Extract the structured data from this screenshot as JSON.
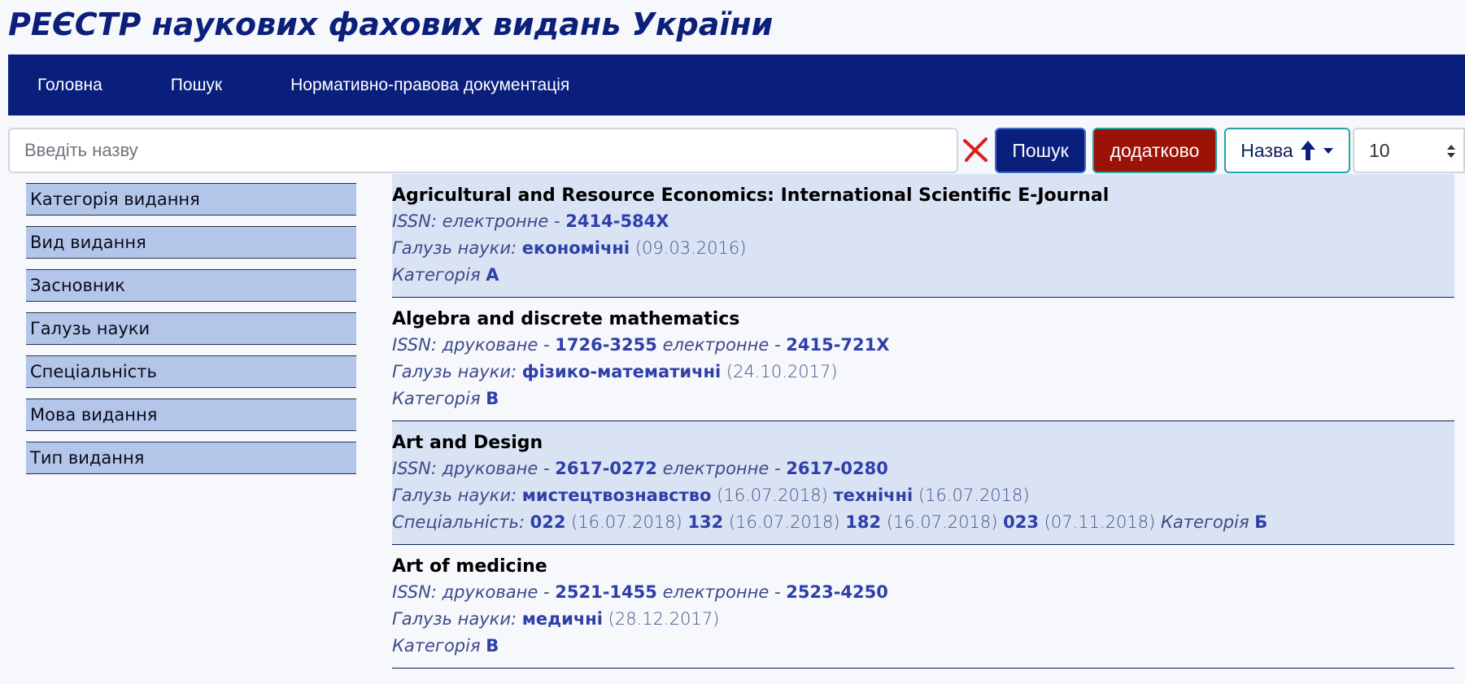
{
  "header": {
    "title_strong": "РЕЄСТР",
    "title_rest": " наукових фахових видань України"
  },
  "nav": {
    "items": [
      "Головна",
      "Пошук",
      "Нормативно-правова документація"
    ]
  },
  "search": {
    "placeholder": "Введіть назву",
    "button_label": "Пошук",
    "extra_label": "додатково",
    "sort_label": "Назва",
    "per_page": "10"
  },
  "sidebar": {
    "items": [
      "Категорія видання",
      "Вид видання",
      "Засновник",
      "Галузь науки",
      "Спеціальність",
      "Мова видання",
      "Тип видання"
    ]
  },
  "labels": {
    "issn": "ISSN:",
    "printed": "друковане",
    "electronic": "електронне",
    "dash": "-",
    "field": "Галузь науки:",
    "specialty": "Спеціальність:",
    "category": "Категорія"
  },
  "results": [
    {
      "title": "Agricultural and Resource Economics: International Scientific E-Journal",
      "issn_electronic": "2414-584X",
      "fields": [
        {
          "name": "економічні",
          "date": "(09.03.2016)"
        }
      ],
      "category": "А"
    },
    {
      "title": "Algebra and discrete mathematics",
      "issn_printed": "1726-3255",
      "issn_electronic": "2415-721X",
      "fields": [
        {
          "name": "фізико-математичні",
          "date": "(24.10.2017)"
        }
      ],
      "category": "В"
    },
    {
      "title": "Art and Design",
      "issn_printed": "2617-0272",
      "issn_electronic": "2617-0280",
      "fields": [
        {
          "name": "мистецтвознавство",
          "date": "(16.07.2018)"
        },
        {
          "name": "технічні",
          "date": "(16.07.2018)"
        }
      ],
      "specialties": [
        {
          "code": "022",
          "date": "(16.07.2018)"
        },
        {
          "code": "132",
          "date": "(16.07.2018)"
        },
        {
          "code": "182",
          "date": "(16.07.2018)"
        },
        {
          "code": "023",
          "date": "(07.11.2018)"
        }
      ],
      "category": "Б"
    },
    {
      "title": "Art of medicine",
      "issn_printed": "2521-1455",
      "issn_electronic": "2523-4250",
      "fields": [
        {
          "name": "медичні",
          "date": "(28.12.2017)"
        }
      ],
      "category": "В"
    }
  ],
  "colors": {
    "brand": "#0a1f7c",
    "extra_button": "#9b1206",
    "sidebar_item": "#b3c6ea",
    "shaded_row": "#d9e3f4",
    "link": "#2f3fa8"
  }
}
